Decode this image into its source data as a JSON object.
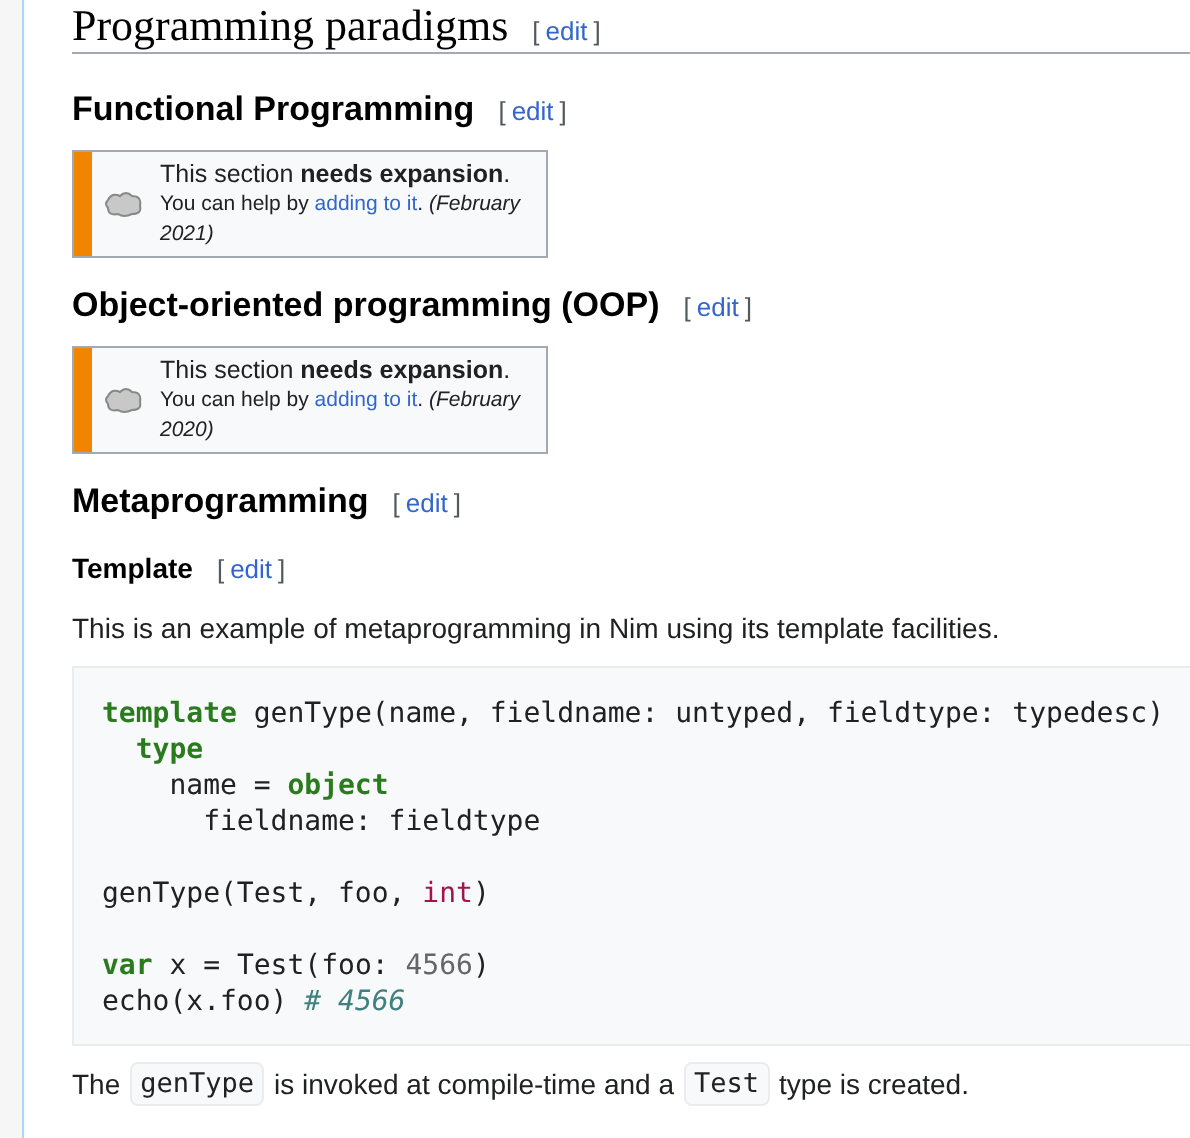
{
  "blocks": [
    {
      "kind": "h2",
      "title": "Programming paradigms",
      "edit": {
        "open": "[",
        "label": "edit",
        "close": "]"
      }
    },
    {
      "kind": "h3",
      "title": "Functional Programming",
      "edit": {
        "open": "[",
        "label": "edit",
        "close": "]"
      }
    },
    {
      "kind": "notice",
      "title": "This section **needs expansion**.",
      "before": "You can help by ",
      "link": "adding to it",
      "after": ". *(February 2021)*"
    },
    {
      "kind": "h3",
      "title": "Object-oriented programming (OOP)",
      "edit": {
        "open": "[",
        "label": "edit",
        "close": "]"
      }
    },
    {
      "kind": "notice",
      "title": "This section **needs expansion**.",
      "before": "You can help by ",
      "link": "adding to it",
      "after": ". *(February 2020)*"
    },
    {
      "kind": "h3",
      "title": "Metaprogramming",
      "edit": {
        "open": "[",
        "label": "edit",
        "close": "]"
      }
    },
    {
      "kind": "h4",
      "title": "Template",
      "edit": {
        "open": "[",
        "label": "edit",
        "close": "]"
      }
    },
    {
      "kind": "paragraph",
      "parts": [
        {
          "kind": "text",
          "text": "This is an example of metaprogramming in Nim using its template facilities."
        }
      ]
    },
    {
      "kind": "code",
      "lines": [
        {
          "tokens": [
            {
              "kind": "keyword",
              "text": "template"
            },
            {
              "kind": "plain",
              "text": " genType(name, fieldname: untyped, fieldtype: typedesc)"
            }
          ]
        },
        {
          "tokens": [
            {
              "kind": "keyword",
              "text": "  type"
            }
          ]
        },
        {
          "tokens": [
            {
              "kind": "plain",
              "text": "    name = "
            },
            {
              "kind": "keyword",
              "text": "object"
            }
          ]
        },
        {
          "tokens": [
            {
              "kind": "plain",
              "text": "      fieldname: fieldtype"
            }
          ]
        },
        {
          "gap_before": true,
          "tokens": [
            {
              "kind": "plain",
              "text": "genType(Test, foo, "
            },
            {
              "kind": "builtin",
              "text": "int"
            },
            {
              "kind": "plain",
              "text": ")"
            }
          ]
        },
        {
          "gap_before": true,
          "tokens": [
            {
              "kind": "keyword",
              "text": "var"
            },
            {
              "kind": "plain",
              "text": " x = Test(foo: "
            },
            {
              "kind": "number",
              "text": "4566"
            },
            {
              "kind": "plain",
              "text": ")"
            }
          ]
        },
        {
          "tokens": [
            {
              "kind": "plain",
              "text": "echo(x.foo) "
            },
            {
              "kind": "comment",
              "text": "# 4566"
            }
          ]
        }
      ]
    },
    {
      "kind": "paragraph",
      "parts": [
        {
          "kind": "text",
          "text": "The"
        },
        {
          "kind": "code",
          "text": "genType"
        },
        {
          "kind": "text",
          "text": "is invoked at compile-time and a"
        },
        {
          "kind": "code",
          "text": "Test"
        },
        {
          "kind": "text",
          "text": "type is created."
        }
      ]
    }
  ]
}
